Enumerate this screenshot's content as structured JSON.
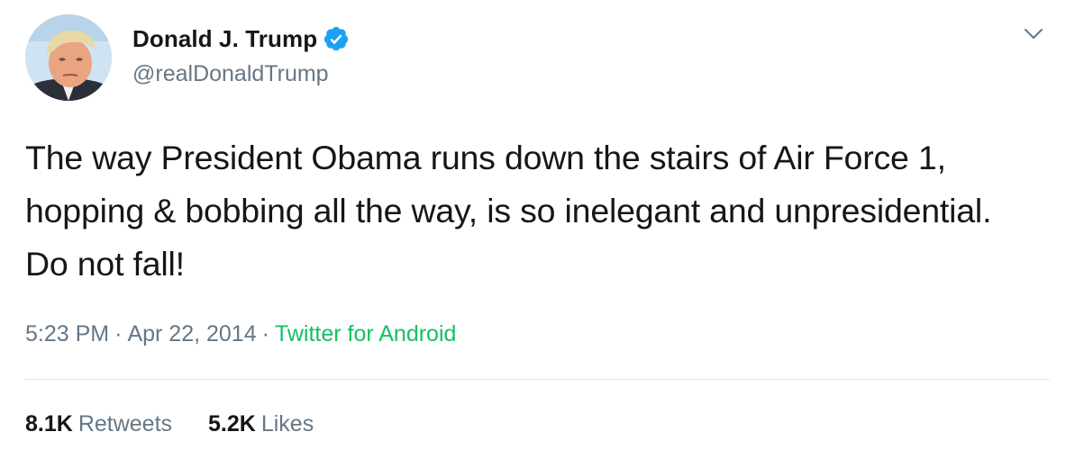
{
  "author": {
    "display_name": "Donald J. Trump",
    "handle": "@realDonaldTrump",
    "verified": true,
    "avatar_icon": "profile-photo"
  },
  "tweet": {
    "text": "The way President Obama runs down the stairs of Air Force 1, hopping & bobbing all the way, is so inelegant and unpresidential. Do not fall!",
    "time": "5:23 PM",
    "separator": "·",
    "date": "Apr 22, 2014",
    "source": "Twitter for Android"
  },
  "stats": {
    "retweets_count": "8.1K",
    "retweets_label": "Retweets",
    "likes_count": "5.2K",
    "likes_label": "Likes"
  },
  "colors": {
    "verified_badge": "#1da1f2",
    "source_link": "#17bf63",
    "secondary_text": "#657786",
    "primary_text": "#14171a",
    "divider": "#e1e8ed"
  },
  "icons": {
    "verified": "verified-badge-icon",
    "menu": "chevron-down-icon"
  }
}
